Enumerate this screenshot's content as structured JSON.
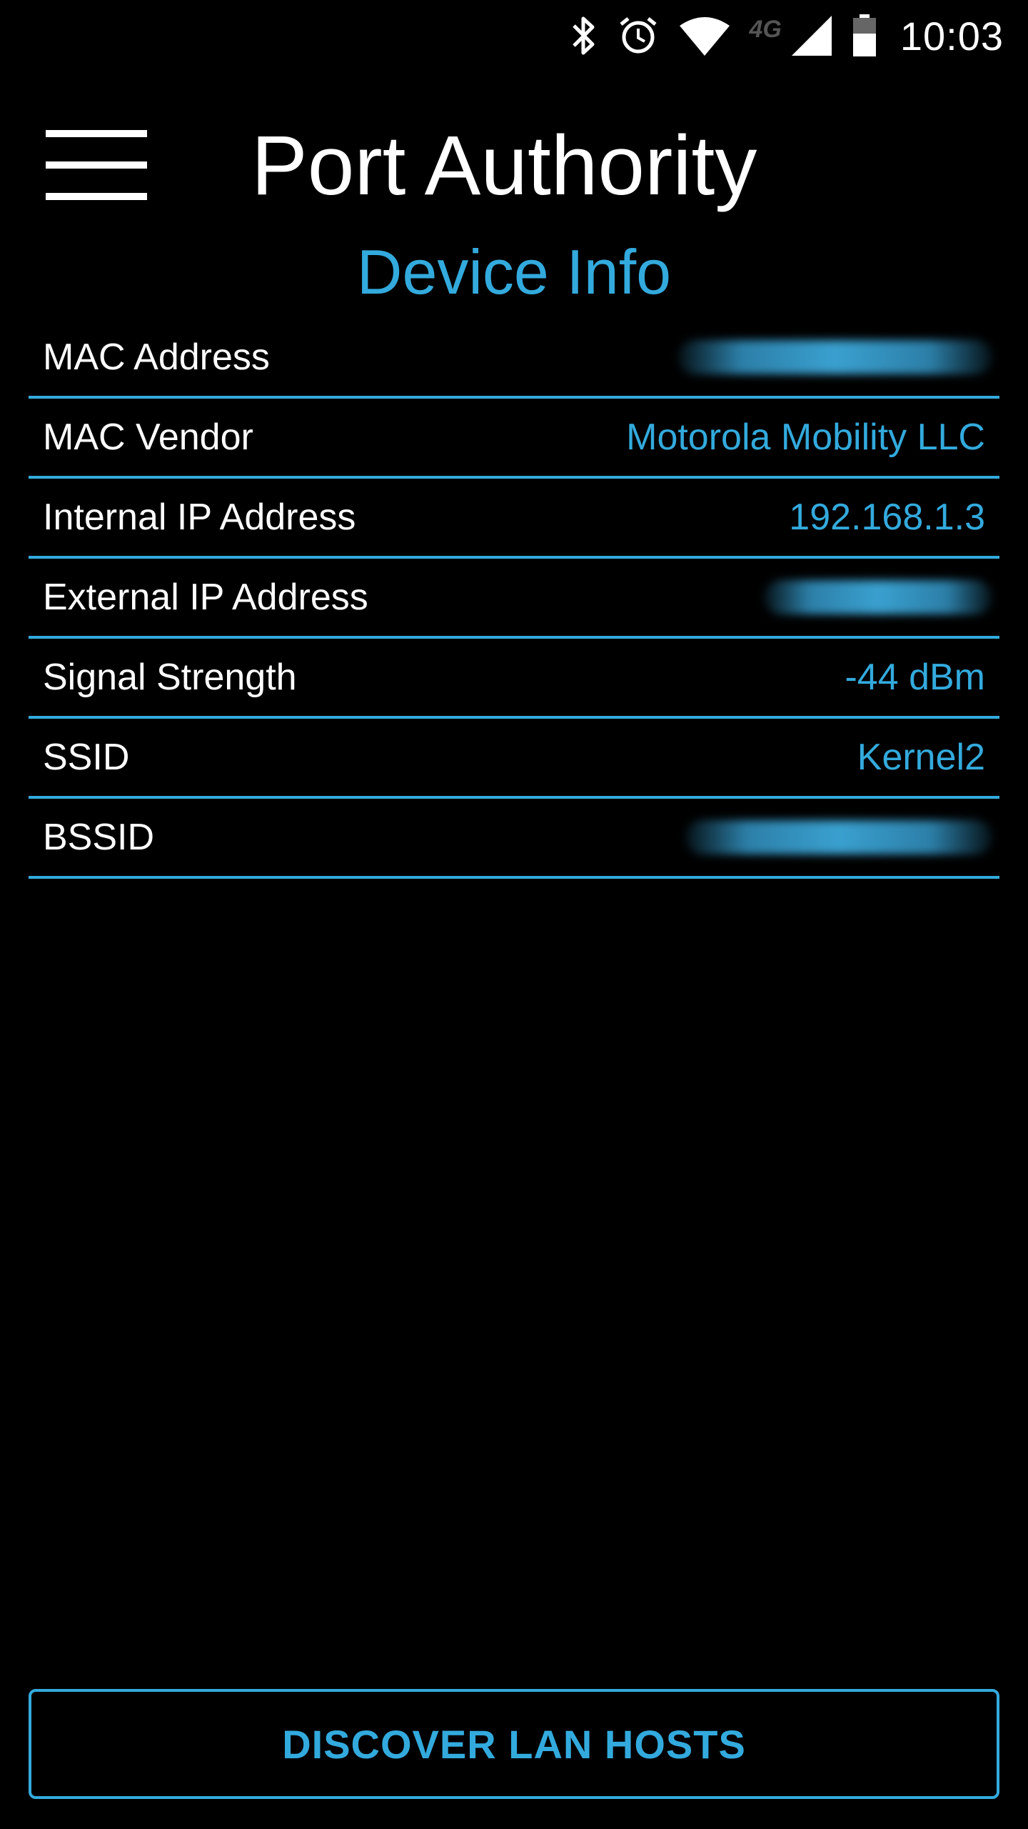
{
  "status_bar": {
    "time": "10:03",
    "network_label": "4G",
    "icons": [
      "bluetooth-icon",
      "alarm-icon",
      "wifi-icon",
      "lte-icon",
      "cell-signal-icon",
      "battery-icon"
    ]
  },
  "toolbar": {
    "title": "Port Authority",
    "menu_icon": "hamburger-menu-icon"
  },
  "section": {
    "title": "Device Info"
  },
  "device_info": {
    "rows": [
      {
        "label": "MAC Address",
        "value": "",
        "redacted": true
      },
      {
        "label": "MAC Vendor",
        "value": "Motorola Mobility LLC",
        "redacted": false
      },
      {
        "label": "Internal IP Address",
        "value": "192.168.1.3",
        "redacted": false
      },
      {
        "label": "External IP Address",
        "value": "",
        "redacted": true
      },
      {
        "label": "Signal Strength",
        "value": "-44 dBm",
        "redacted": false
      },
      {
        "label": "SSID",
        "value": "Kernel2",
        "redacted": false
      },
      {
        "label": "BSSID",
        "value": "",
        "redacted": true
      }
    ]
  },
  "actions": {
    "discover_label": "DISCOVER LAN HOSTS"
  },
  "colors": {
    "accent": "#33aadd",
    "background": "#000000",
    "text": "#ffffff"
  }
}
